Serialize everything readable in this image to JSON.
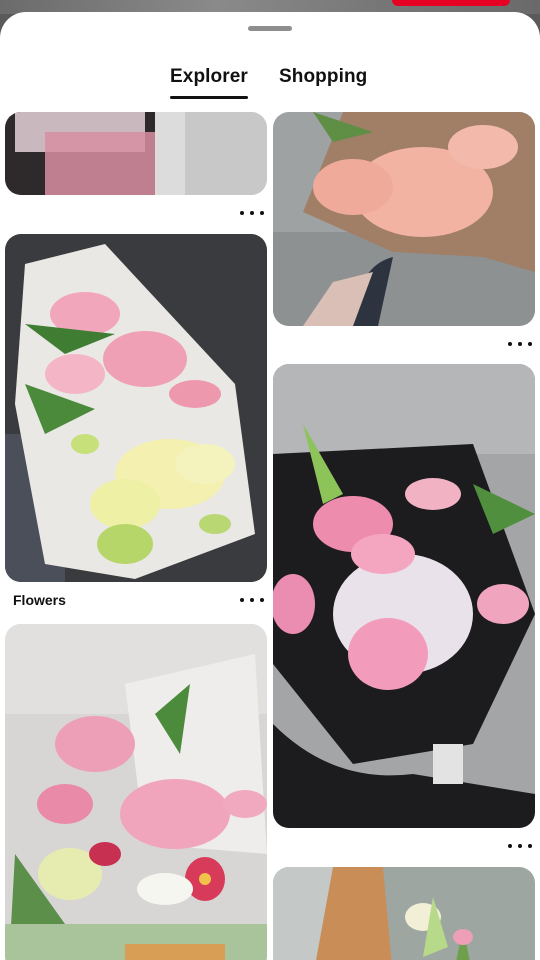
{
  "tabs": {
    "explorer_label": "Explorer",
    "shopping_label": "Shopping",
    "active": "explorer"
  },
  "pins": {
    "flowers_title": "Flowers"
  },
  "colors": {
    "accent": "#e60023",
    "text": "#111111",
    "sheet": "#ffffff"
  },
  "icons": {
    "grabber": "drag-handle",
    "more": "ellipsis-horizontal-icon"
  }
}
